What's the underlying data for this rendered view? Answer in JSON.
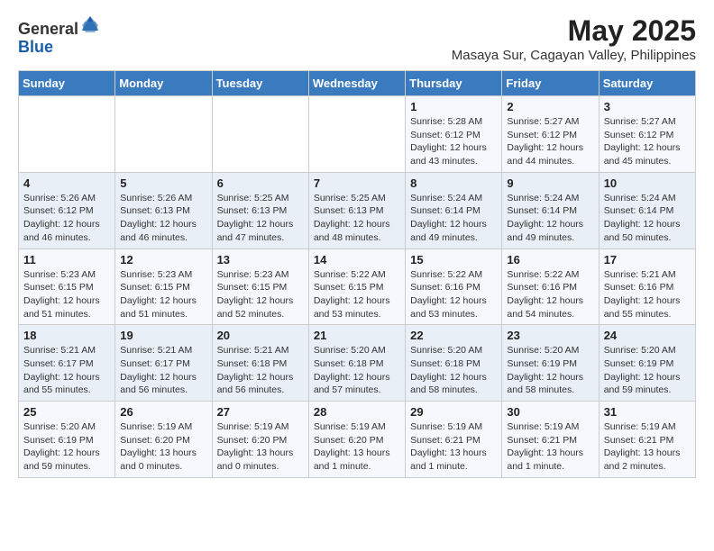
{
  "header": {
    "logo_general": "General",
    "logo_blue": "Blue",
    "month_year": "May 2025",
    "subtitle": "Masaya Sur, Cagayan Valley, Philippines"
  },
  "weekdays": [
    "Sunday",
    "Monday",
    "Tuesday",
    "Wednesday",
    "Thursday",
    "Friday",
    "Saturday"
  ],
  "weeks": [
    [
      {
        "day": "",
        "info": ""
      },
      {
        "day": "",
        "info": ""
      },
      {
        "day": "",
        "info": ""
      },
      {
        "day": "",
        "info": ""
      },
      {
        "day": "1",
        "info": "Sunrise: 5:28 AM\nSunset: 6:12 PM\nDaylight: 12 hours\nand 43 minutes."
      },
      {
        "day": "2",
        "info": "Sunrise: 5:27 AM\nSunset: 6:12 PM\nDaylight: 12 hours\nand 44 minutes."
      },
      {
        "day": "3",
        "info": "Sunrise: 5:27 AM\nSunset: 6:12 PM\nDaylight: 12 hours\nand 45 minutes."
      }
    ],
    [
      {
        "day": "4",
        "info": "Sunrise: 5:26 AM\nSunset: 6:12 PM\nDaylight: 12 hours\nand 46 minutes."
      },
      {
        "day": "5",
        "info": "Sunrise: 5:26 AM\nSunset: 6:13 PM\nDaylight: 12 hours\nand 46 minutes."
      },
      {
        "day": "6",
        "info": "Sunrise: 5:25 AM\nSunset: 6:13 PM\nDaylight: 12 hours\nand 47 minutes."
      },
      {
        "day": "7",
        "info": "Sunrise: 5:25 AM\nSunset: 6:13 PM\nDaylight: 12 hours\nand 48 minutes."
      },
      {
        "day": "8",
        "info": "Sunrise: 5:24 AM\nSunset: 6:14 PM\nDaylight: 12 hours\nand 49 minutes."
      },
      {
        "day": "9",
        "info": "Sunrise: 5:24 AM\nSunset: 6:14 PM\nDaylight: 12 hours\nand 49 minutes."
      },
      {
        "day": "10",
        "info": "Sunrise: 5:24 AM\nSunset: 6:14 PM\nDaylight: 12 hours\nand 50 minutes."
      }
    ],
    [
      {
        "day": "11",
        "info": "Sunrise: 5:23 AM\nSunset: 6:15 PM\nDaylight: 12 hours\nand 51 minutes."
      },
      {
        "day": "12",
        "info": "Sunrise: 5:23 AM\nSunset: 6:15 PM\nDaylight: 12 hours\nand 51 minutes."
      },
      {
        "day": "13",
        "info": "Sunrise: 5:23 AM\nSunset: 6:15 PM\nDaylight: 12 hours\nand 52 minutes."
      },
      {
        "day": "14",
        "info": "Sunrise: 5:22 AM\nSunset: 6:15 PM\nDaylight: 12 hours\nand 53 minutes."
      },
      {
        "day": "15",
        "info": "Sunrise: 5:22 AM\nSunset: 6:16 PM\nDaylight: 12 hours\nand 53 minutes."
      },
      {
        "day": "16",
        "info": "Sunrise: 5:22 AM\nSunset: 6:16 PM\nDaylight: 12 hours\nand 54 minutes."
      },
      {
        "day": "17",
        "info": "Sunrise: 5:21 AM\nSunset: 6:16 PM\nDaylight: 12 hours\nand 55 minutes."
      }
    ],
    [
      {
        "day": "18",
        "info": "Sunrise: 5:21 AM\nSunset: 6:17 PM\nDaylight: 12 hours\nand 55 minutes."
      },
      {
        "day": "19",
        "info": "Sunrise: 5:21 AM\nSunset: 6:17 PM\nDaylight: 12 hours\nand 56 minutes."
      },
      {
        "day": "20",
        "info": "Sunrise: 5:21 AM\nSunset: 6:18 PM\nDaylight: 12 hours\nand 56 minutes."
      },
      {
        "day": "21",
        "info": "Sunrise: 5:20 AM\nSunset: 6:18 PM\nDaylight: 12 hours\nand 57 minutes."
      },
      {
        "day": "22",
        "info": "Sunrise: 5:20 AM\nSunset: 6:18 PM\nDaylight: 12 hours\nand 58 minutes."
      },
      {
        "day": "23",
        "info": "Sunrise: 5:20 AM\nSunset: 6:19 PM\nDaylight: 12 hours\nand 58 minutes."
      },
      {
        "day": "24",
        "info": "Sunrise: 5:20 AM\nSunset: 6:19 PM\nDaylight: 12 hours\nand 59 minutes."
      }
    ],
    [
      {
        "day": "25",
        "info": "Sunrise: 5:20 AM\nSunset: 6:19 PM\nDaylight: 12 hours\nand 59 minutes."
      },
      {
        "day": "26",
        "info": "Sunrise: 5:19 AM\nSunset: 6:20 PM\nDaylight: 13 hours\nand 0 minutes."
      },
      {
        "day": "27",
        "info": "Sunrise: 5:19 AM\nSunset: 6:20 PM\nDaylight: 13 hours\nand 0 minutes."
      },
      {
        "day": "28",
        "info": "Sunrise: 5:19 AM\nSunset: 6:20 PM\nDaylight: 13 hours\nand 1 minute."
      },
      {
        "day": "29",
        "info": "Sunrise: 5:19 AM\nSunset: 6:21 PM\nDaylight: 13 hours\nand 1 minute."
      },
      {
        "day": "30",
        "info": "Sunrise: 5:19 AM\nSunset: 6:21 PM\nDaylight: 13 hours\nand 1 minute."
      },
      {
        "day": "31",
        "info": "Sunrise: 5:19 AM\nSunset: 6:21 PM\nDaylight: 13 hours\nand 2 minutes."
      }
    ]
  ]
}
